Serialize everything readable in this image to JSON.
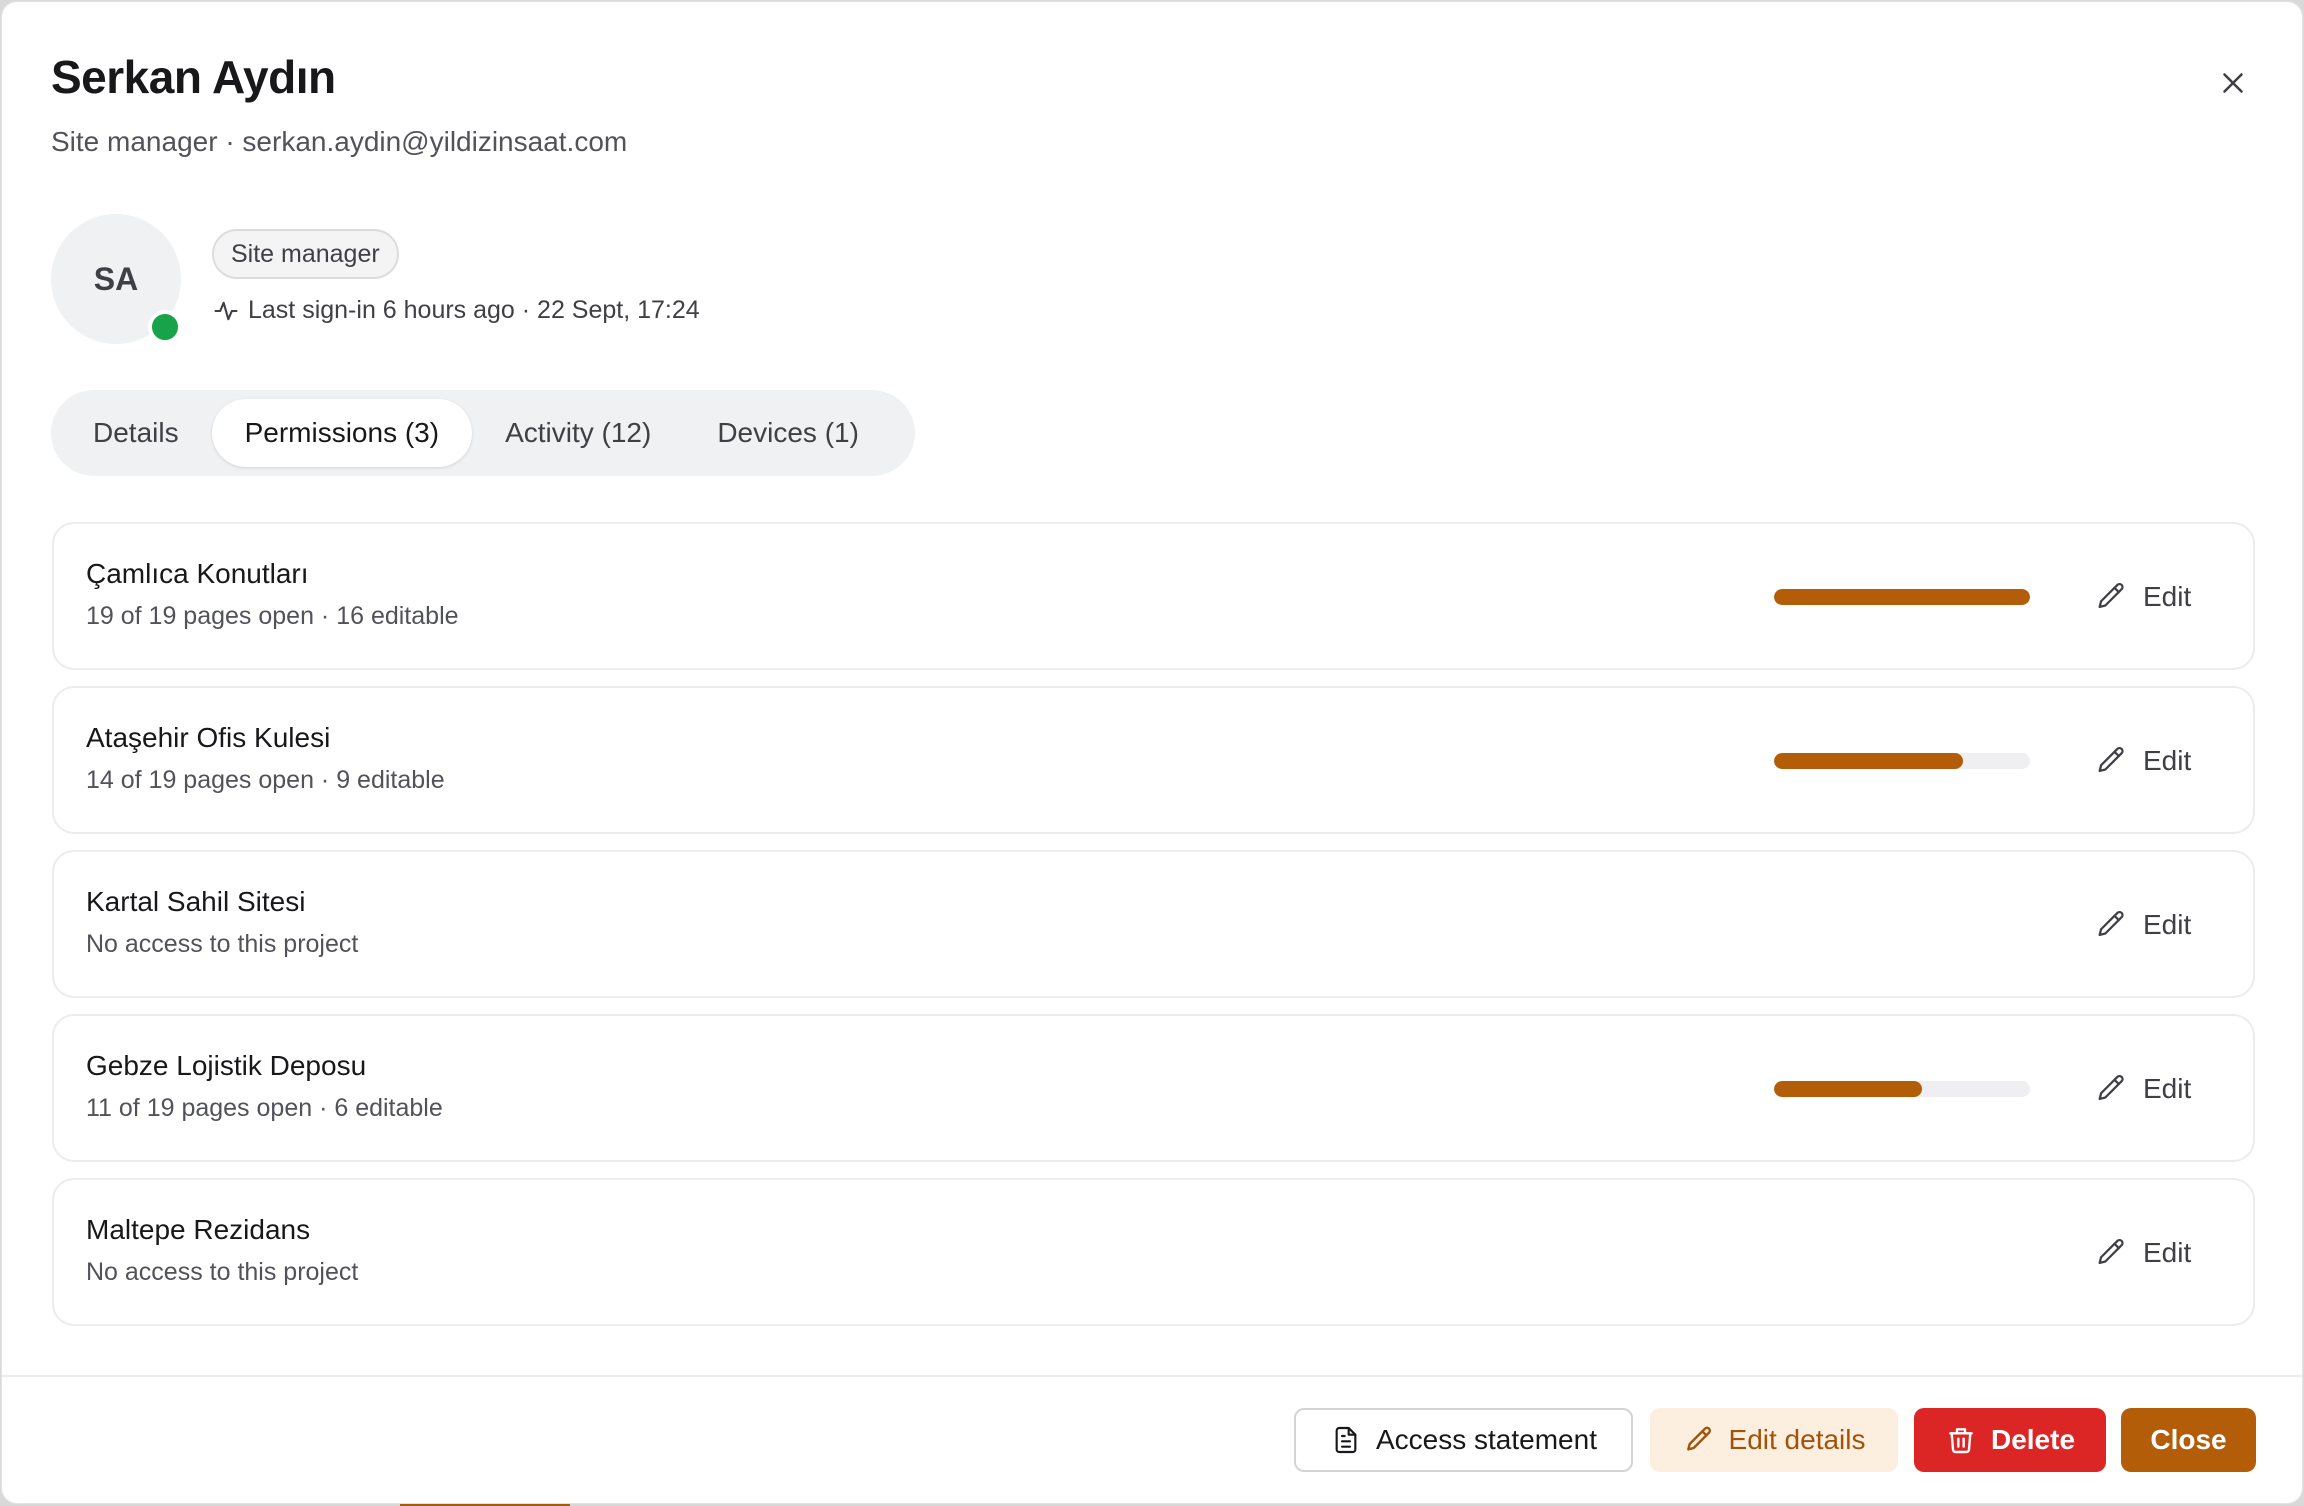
{
  "dialog": {
    "title": "Serkan Aydın",
    "subtitle": "Site manager · serkan.aydin@yildizinsaat.com",
    "close_icon": "close-icon"
  },
  "profile": {
    "initials": "SA",
    "status": "online",
    "status_color": "#16a34a",
    "role_badge": "Site manager",
    "last_signin": "Last sign-in 6 hours ago · 22 Sept, 17:24"
  },
  "tabs": [
    {
      "label": "Details",
      "active": false
    },
    {
      "label": "Permissions (3)",
      "active": true
    },
    {
      "label": "Activity (12)",
      "active": false
    },
    {
      "label": "Devices (1)",
      "active": false
    }
  ],
  "permissions": [
    {
      "name": "Çamlıca Konutları",
      "meta": "19 of 19 pages open · 16 editable",
      "progress": 1.0,
      "edit_label": "Edit"
    },
    {
      "name": "Ataşehir Ofis Kulesi",
      "meta": "14 of 19 pages open · 9 editable",
      "progress": 0.737,
      "edit_label": "Edit"
    },
    {
      "name": "Kartal Sahil Sitesi",
      "meta": "No access to this project",
      "progress": null,
      "edit_label": "Edit"
    },
    {
      "name": "Gebze Lojistik Deposu",
      "meta": "11 of 19 pages open · 6 editable",
      "progress": 0.579,
      "edit_label": "Edit"
    },
    {
      "name": "Maltepe Rezidans",
      "meta": "No access to this project",
      "progress": null,
      "edit_label": "Edit"
    }
  ],
  "footer": {
    "access_statement": "Access statement",
    "edit_details": "Edit details",
    "delete": "Delete",
    "close": "Close"
  },
  "colors": {
    "accent": "#b45d09",
    "danger": "#dc2626",
    "accent_soft": "#fcefe0"
  }
}
